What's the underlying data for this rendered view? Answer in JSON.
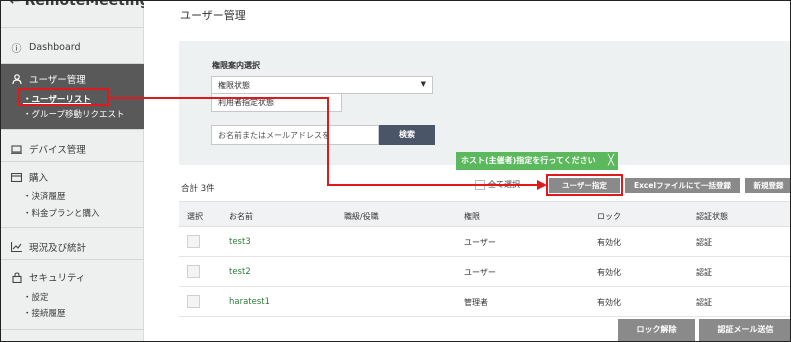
{
  "app": {
    "logo_text": "RemoteMeeting"
  },
  "sidebar": {
    "items": [
      {
        "label": "Dashboard",
        "icon": "info-circle-icon"
      },
      {
        "label": "ユーザー管理",
        "icon": "person-icon"
      },
      {
        "label": "デバイス管理",
        "icon": "device-icon"
      },
      {
        "label": "購入",
        "icon": "card-icon"
      },
      {
        "label": "現況及び統計",
        "icon": "chart-icon"
      },
      {
        "label": "セキュリティ",
        "icon": "lock-icon"
      }
    ],
    "user_sub": [
      "ユーザーリスト",
      "グループ移動リクエスト"
    ],
    "purchase_sub": [
      "決済履歴",
      "料金プランと購入"
    ],
    "security_sub": [
      "設定",
      "接続履歴"
    ]
  },
  "main": {
    "title": "ユーザー管理",
    "filter": {
      "label": "権限案内選択",
      "select_value": "権限状態",
      "option_text": "利用者指定状態",
      "search_placeholder": "お名前またはメールアドレスを",
      "search_button": "検索"
    },
    "tooltip": "ホスト(主催者)指定を行ってください",
    "tooltip_close": "╳",
    "total": "合計 3件",
    "select_all": "全て選択",
    "buttons": {
      "user_assign": "ユーザー指定",
      "excel": "Excelファイルにて一括登録",
      "new": "新規登録",
      "unlock": "ロック解除",
      "auth_mail": "認証メール送信"
    },
    "table": {
      "headers": [
        "選択",
        "お名前",
        "職級/役職",
        "権限",
        "ロック",
        "認証状態"
      ],
      "rows": [
        {
          "name": "test3",
          "title": "",
          "role": "ユーザー",
          "lock": "有効化",
          "auth": "認証"
        },
        {
          "name": "test2",
          "title": "",
          "role": "ユーザー",
          "lock": "有効化",
          "auth": "認証"
        },
        {
          "name": "haratest1",
          "title": "",
          "role": "管理者",
          "lock": "有効化",
          "auth": "認証"
        }
      ]
    }
  },
  "colors": {
    "highlight": "#e01a1a",
    "tooltip": "#5bb85d",
    "sidebar_active": "#595959",
    "link_green": "#2f7d3a"
  }
}
